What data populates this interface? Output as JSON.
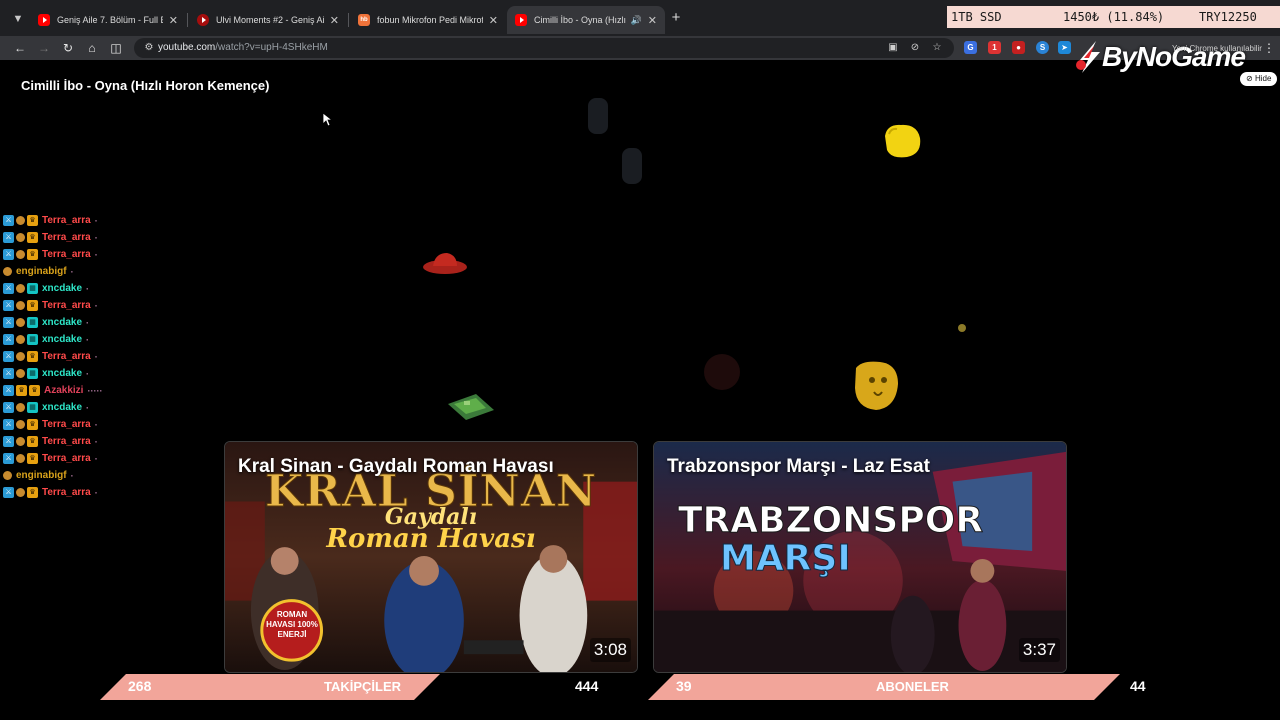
{
  "tabs": [
    {
      "title": "Geniş Aile 7. Bölüm - Full Bölüm",
      "icon": "youtube-icon"
    },
    {
      "title": "Ulvi Moments #2 - Geniş Aile -",
      "icon": "youtube-icon"
    },
    {
      "title": "fobun Mikrofon Pedi Mikrofon S",
      "icon": "hepsiburada-icon"
    },
    {
      "title": "Cimilli İbo - Oyna (Hızlı Hor",
      "icon": "youtube-icon",
      "active": true
    }
  ],
  "toolbar": {
    "url_host": "youtube.com",
    "url_path": "/watch?v=upH-4SHkeHM",
    "update_text": "Yeni Chrome kullanılabilir"
  },
  "price_overlay": {
    "item": "1TB SSD",
    "value": "1450₺ (11.84%)",
    "total": "TRY12250"
  },
  "brand": {
    "name": "ByNoGame",
    "hide_label": "Hide"
  },
  "video": {
    "title": "Cimilli İbo - Oyna (Hızlı Horon Kemençe)"
  },
  "chat": [
    {
      "name": "Terra_arra",
      "color": "#ff4a4a",
      "badges": [
        "mod",
        "gift",
        "crown"
      ],
      "emote": "·"
    },
    {
      "name": "Terra_arra",
      "color": "#ff4a4a",
      "badges": [
        "mod",
        "gift",
        "crown"
      ],
      "emote": "·"
    },
    {
      "name": "Terra_arra",
      "color": "#ff4a4a",
      "badges": [
        "mod",
        "gift",
        "crown"
      ],
      "emote": "·"
    },
    {
      "name": "enginabigf",
      "color": "#d9a21b",
      "badges": [
        "gift"
      ],
      "emote": "·"
    },
    {
      "name": "xncdake",
      "color": "#2ee6c8",
      "badges": [
        "mod",
        "gift",
        "cyan"
      ],
      "emote": "·"
    },
    {
      "name": "Terra_arra",
      "color": "#ff4a4a",
      "badges": [
        "mod",
        "gift",
        "crown"
      ],
      "emote": "·"
    },
    {
      "name": "xncdake",
      "color": "#2ee6c8",
      "badges": [
        "mod",
        "gift",
        "cyan"
      ],
      "emote": "·"
    },
    {
      "name": "xncdake",
      "color": "#2ee6c8",
      "badges": [
        "mod",
        "gift",
        "cyan"
      ],
      "emote": "·"
    },
    {
      "name": "Terra_arra",
      "color": "#ff4a4a",
      "badges": [
        "mod",
        "gift",
        "crown"
      ],
      "emote": "·"
    },
    {
      "name": "xncdake",
      "color": "#2ee6c8",
      "badges": [
        "mod",
        "gift",
        "cyan"
      ],
      "emote": "·"
    },
    {
      "name": "Azakkizi",
      "color": "#e0425a",
      "badges": [
        "mod",
        "crown",
        "crown"
      ],
      "emote": "·····"
    },
    {
      "name": "xncdake",
      "color": "#2ee6c8",
      "badges": [
        "mod",
        "gift",
        "cyan"
      ],
      "emote": "·"
    },
    {
      "name": "Terra_arra",
      "color": "#ff4a4a",
      "badges": [
        "mod",
        "gift",
        "crown"
      ],
      "emote": "·"
    },
    {
      "name": "Terra_arra",
      "color": "#ff4a4a",
      "badges": [
        "mod",
        "gift",
        "crown"
      ],
      "emote": "·"
    },
    {
      "name": "Terra_arra",
      "color": "#ff4a4a",
      "badges": [
        "mod",
        "gift",
        "crown"
      ],
      "emote": "·"
    },
    {
      "name": "enginabigf",
      "color": "#d9a21b",
      "badges": [
        "gift"
      ],
      "emote": "·"
    },
    {
      "name": "Terra_arra",
      "color": "#ff4a4a",
      "badges": [
        "mod",
        "gift",
        "crown"
      ],
      "emote": "·"
    }
  ],
  "cards": [
    {
      "title": "Kral Sinan - Gaydalı Roman Havası",
      "duration": "3:08",
      "art_line1": "KRAL SİNAN",
      "art_line2": "Gaydalı",
      "art_line3": "Roman Havası",
      "stamp": "ROMAN HAVASI 100% ENERJİ"
    },
    {
      "title": "Trabzonspor Marşı - Laz Esat",
      "duration": "3:37",
      "art_line1": "TRABZONSPOR",
      "art_line2": "MARŞI"
    }
  ],
  "stats": [
    {
      "left": "268",
      "label": "TAKİPÇİLER",
      "right": "444"
    },
    {
      "left": "39",
      "label": "ABONELER",
      "right": "44"
    }
  ],
  "colors": {
    "banner": "#f2a59a",
    "accent": "#ff0000"
  }
}
